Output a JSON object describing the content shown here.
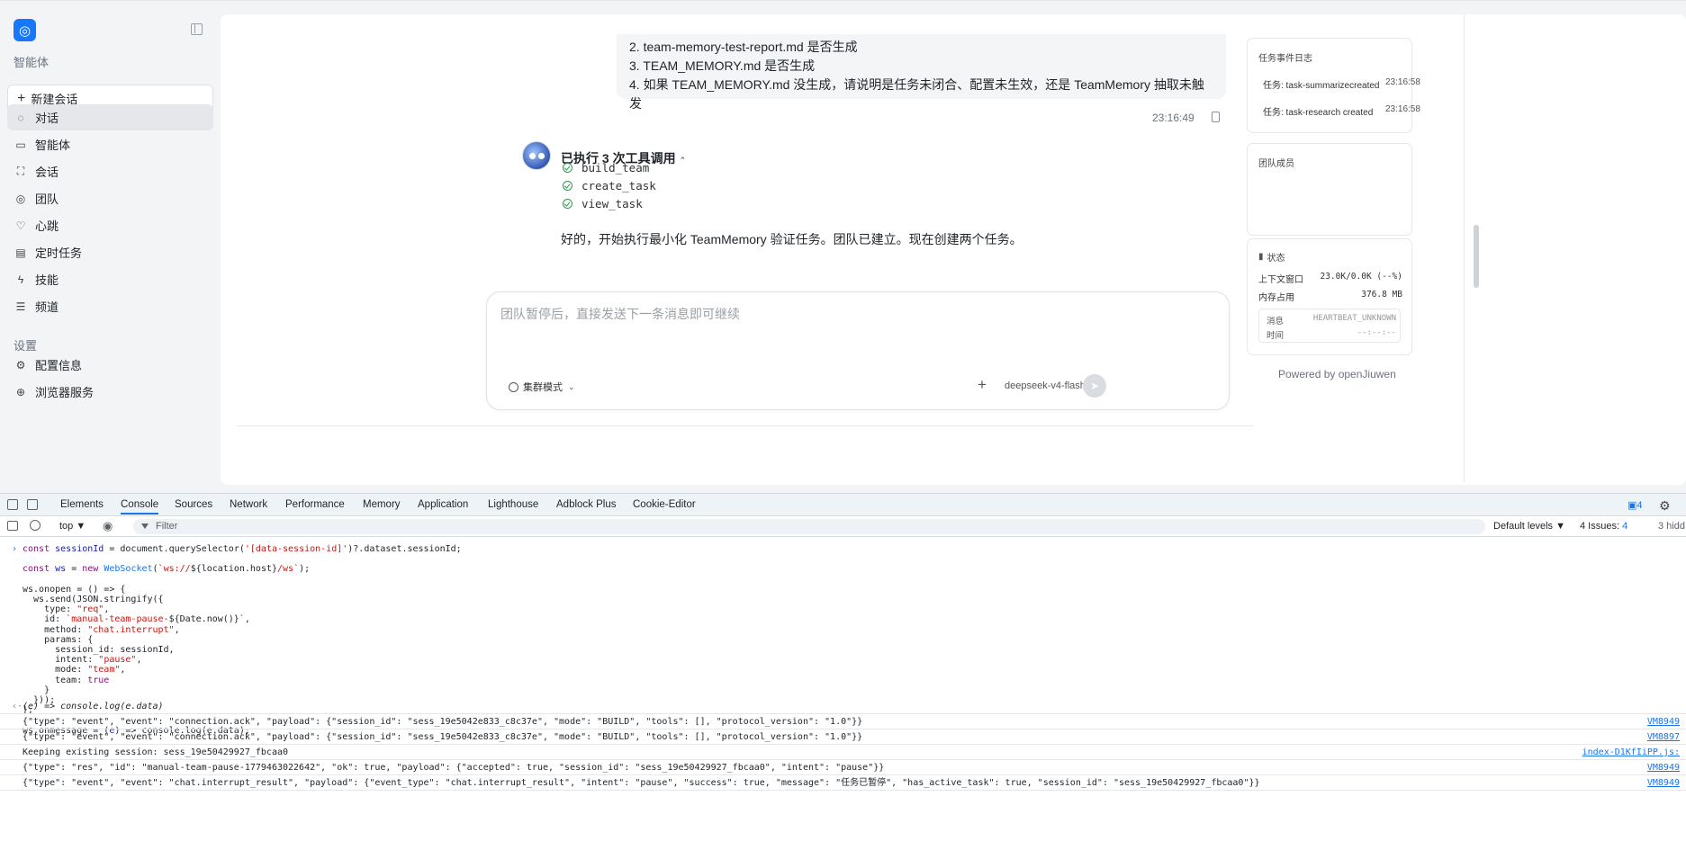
{
  "sidebar": {
    "section_agents": "智能体",
    "new_chat": "新建会话",
    "nav": [
      {
        "label": "对话",
        "icon": "chat-bubble-icon"
      },
      {
        "label": "智能体",
        "icon": "monitor-icon"
      },
      {
        "label": "会话",
        "icon": "scan-icon"
      },
      {
        "label": "团队",
        "icon": "team-icon"
      },
      {
        "label": "心跳",
        "icon": "heart-icon"
      },
      {
        "label": "定时任务",
        "icon": "clipboard-icon"
      },
      {
        "label": "技能",
        "icon": "bolt-icon"
      },
      {
        "label": "频道",
        "icon": "list-icon"
      }
    ],
    "section_settings": "设置",
    "settings": [
      {
        "label": "配置信息",
        "icon": "gear-icon"
      },
      {
        "label": "浏览器服务",
        "icon": "globe-icon"
      }
    ]
  },
  "chat": {
    "user_msg_lines": [
      "2. team-memory-test-report.md 是否生成",
      "3. TEAM_MEMORY.md 是否生成",
      "4. 如果 TEAM_MEMORY.md 没生成，请说明是任务未闭合、配置未生效，还是 TeamMemory 抽取未触发"
    ],
    "user_msg_time": "23:16:49",
    "tool_header": "已执行 3 次工具调用",
    "tools": [
      "build_team",
      "create_task",
      "view_task"
    ],
    "assistant_text": "好的，开始执行最小化 TeamMemory 验证任务。团队已建立。现在创建两个任务。",
    "composer": {
      "placeholder": "团队暂停后，直接发送下一条消息即可继续",
      "mode": "集群模式",
      "model": "deepseek-v4-flash"
    }
  },
  "right": {
    "event_log_title": "任务事件日志",
    "events": [
      {
        "text": "任务: task-summarizecreated",
        "time": "23:16:58"
      },
      {
        "text": "任务: task-research  created",
        "time": "23:16:58"
      }
    ],
    "team_members_title": "团队成员",
    "status_title": "状态",
    "context_label": "上下文窗口",
    "context_value": "23.0K/0.0K (--%)",
    "memory_label": "内存占用",
    "memory_value": "376.8 MB",
    "hb_msg_label": "消息",
    "hb_msg_value": "HEARTBEAT_UNKNOWN",
    "hb_time_label": "时间",
    "hb_time_value": "--:--:--",
    "powered": "Powered by openJiuwen"
  },
  "devtools": {
    "tabs": [
      "Elements",
      "Console",
      "Sources",
      "Network",
      "Performance",
      "Memory",
      "Application",
      "Lighthouse",
      "Adblock Plus",
      "Cookie-Editor"
    ],
    "active_tab": "Console",
    "issues_badge": "4",
    "context": "top ▼",
    "filter_placeholder": "Filter",
    "levels": "Default levels ▼",
    "issues_label": "4 Issues:",
    "issues_count": "4",
    "hidden_label": "3 hidd",
    "return_line": "(e) => console.log(e.data)",
    "logs": [
      {
        "text": "{\"type\": \"event\", \"event\": \"connection.ack\", \"payload\": {\"session_id\": \"sess_19e5042e833_c8c37e\", \"mode\": \"BUILD\", \"tools\": [], \"protocol_version\": \"1.0\"}}",
        "src": "VM8949"
      },
      {
        "text": "{\"type\": \"event\", \"event\": \"connection.ack\", \"payload\": {\"session_id\": \"sess_19e5042e833_c8c37e\", \"mode\": \"BUILD\", \"tools\": [], \"protocol_version\": \"1.0\"}}",
        "src": "VM8897"
      },
      {
        "text": "Keeping existing session: sess_19e50429927_fbcaa0",
        "src": "index-D1KfIiPP.js:"
      },
      {
        "text": "{\"type\": \"res\", \"id\": \"manual-team-pause-1779463022642\", \"ok\": true, \"payload\": {\"accepted\": true, \"session_id\": \"sess_19e50429927_fbcaa0\", \"intent\": \"pause\"}}",
        "src": "VM8949"
      },
      {
        "text": "{\"type\": \"event\", \"event\": \"chat.interrupt_result\", \"payload\": {\"event_type\": \"chat.interrupt_result\", \"intent\": \"pause\", \"success\": true, \"message\": \"任务已暂停\", \"has_active_task\": true, \"session_id\": \"sess_19e50429927_fbcaa0\"}}",
        "src": "VM8949"
      }
    ]
  }
}
